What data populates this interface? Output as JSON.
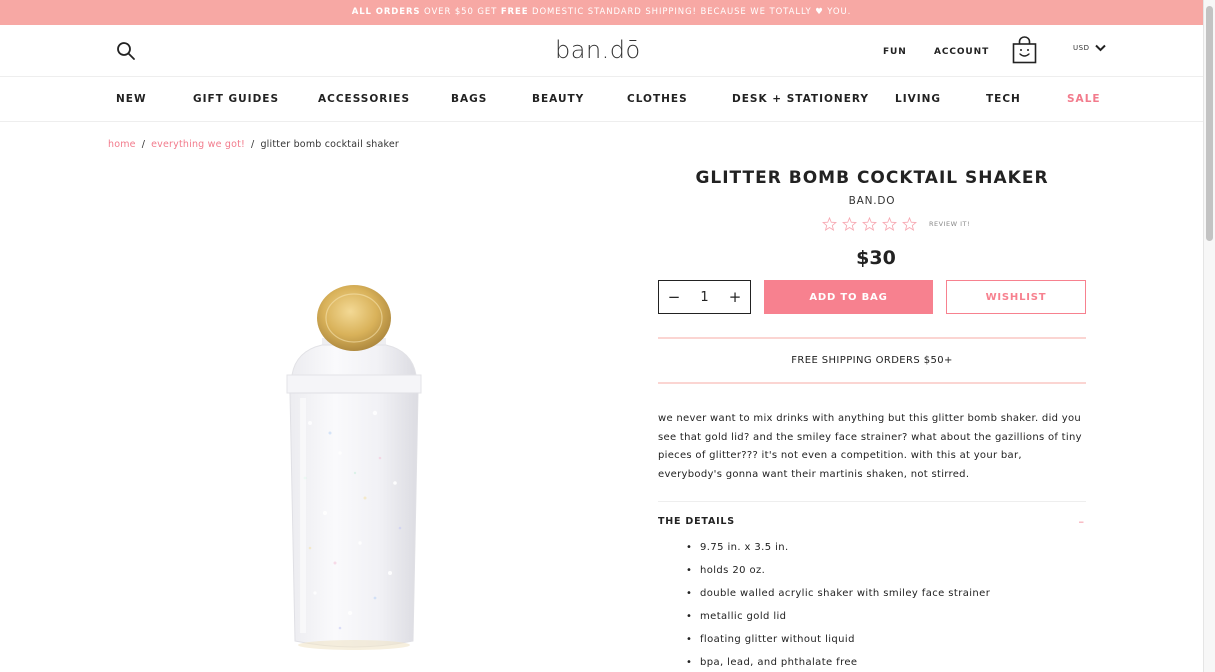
{
  "promo": {
    "prefix_bold": "ALL ORDERS",
    "text1": " OVER $50 GET ",
    "free_bold": "FREE",
    "text2": " DOMESTIC STANDARD SHIPPING! BECAUSE WE TOTALLY ",
    "heart": "♥",
    "text3": " YOU."
  },
  "header": {
    "logo": "ban.dō",
    "links": {
      "fun": "FUN",
      "account": "ACCOUNT"
    },
    "currency": "USD",
    "icons": {
      "search": "search-icon",
      "bag": "smiley-bag-icon",
      "currency_chevron": "chevron-down-icon"
    }
  },
  "nav": {
    "items": [
      "NEW",
      "GIFT GUIDES",
      "ACCESSORIES",
      "BAGS",
      "BEAUTY",
      "CLOTHES",
      "DESK + STATIONERY",
      "LIVING",
      "TECH",
      "SALE"
    ],
    "accent_color": "#f27b8c"
  },
  "breadcrumb": {
    "home": "home",
    "category": "everything we got!",
    "current": "glitter bomb cocktail shaker",
    "separator": "/"
  },
  "product": {
    "title": "GLITTER BOMB COCKTAIL SHAKER",
    "brand": "BAN.DO",
    "rating_stars": 5,
    "rating_value": 0,
    "review_link": "REVIEW IT!",
    "price": "$30",
    "quantity": "1",
    "qty_minus": "−",
    "qty_plus": "+",
    "add_to_bag": "ADD TO BAG",
    "wishlist": "WISHLIST",
    "shipping_note": "FREE SHIPPING ORDERS $50+",
    "description": "we never want to mix drinks with anything but this glitter bomb shaker. did you see that gold lid? and the smiley face strainer? what about the gazillions of tiny pieces of glitter??? it's not even a competition. with this at your bar, everybody's gonna want their martinis shaken, not stirred.",
    "details_title": "THE DETAILS",
    "details_toggle": "–",
    "details": [
      "9.75 in. x 3.5 in.",
      "holds 20 oz.",
      "double walled acrylic shaker with smiley face strainer",
      "metallic gold lid",
      "floating glitter without liquid",
      "bpa, lead, and phthalate free"
    ]
  },
  "colors": {
    "promo_bg": "#f7a8a4",
    "button_pink": "#f7818f",
    "divider_pink": "#fbd5d2",
    "lid_gold": "#d9b25a"
  }
}
